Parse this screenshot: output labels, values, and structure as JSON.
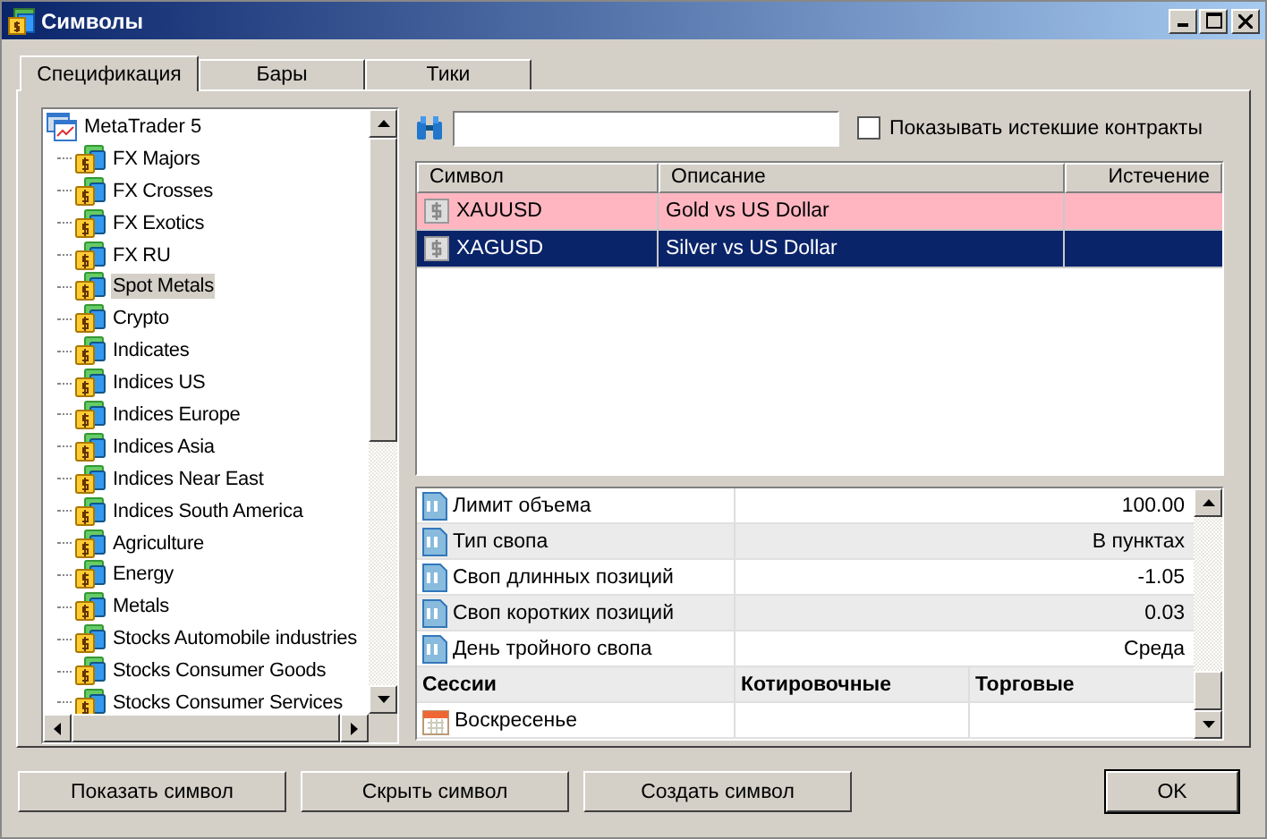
{
  "window": {
    "title": "Символы"
  },
  "tabs": [
    {
      "label": "Спецификация",
      "selected": true
    },
    {
      "label": "Бары",
      "selected": false
    },
    {
      "label": "Тики",
      "selected": false
    }
  ],
  "tree": {
    "label": "MetaTrader 5",
    "children": [
      {
        "label": "FX Majors",
        "selected": false
      },
      {
        "label": "FX Crosses",
        "selected": false
      },
      {
        "label": "FX Exotics",
        "selected": false
      },
      {
        "label": "FX RU",
        "selected": false
      },
      {
        "label": "Spot Metals",
        "selected": true
      },
      {
        "label": "Crypto",
        "selected": false
      },
      {
        "label": "Indicates",
        "selected": false
      },
      {
        "label": "Indices US",
        "selected": false
      },
      {
        "label": "Indices Europe",
        "selected": false
      },
      {
        "label": "Indices Asia",
        "selected": false
      },
      {
        "label": "Indices Near East",
        "selected": false
      },
      {
        "label": "Indices South America",
        "selected": false
      },
      {
        "label": "Agriculture",
        "selected": false
      },
      {
        "label": "Energy",
        "selected": false
      },
      {
        "label": "Metals",
        "selected": false
      },
      {
        "label": "Stocks Automobile industries",
        "selected": false
      },
      {
        "label": "Stocks Consumer Goods",
        "selected": false
      },
      {
        "label": "Stocks Consumer Services",
        "selected": false
      }
    ]
  },
  "search": {
    "show_expired_label": "Показывать истекшие контракты",
    "show_expired_checked": false
  },
  "symbols": {
    "columns": [
      "Символ",
      "Описание",
      "Истечение"
    ],
    "rows": [
      {
        "symbol": "XAUUSD",
        "description": "Gold vs US Dollar",
        "color": "#ffb6c1",
        "selected": false
      },
      {
        "symbol": "XAGUSD",
        "description": "Silver vs US Dollar",
        "color": "#0a246a",
        "selected": true
      }
    ]
  },
  "properties": [
    {
      "name": "Лимит объема",
      "value": "100.00"
    },
    {
      "name": "Тип свопа",
      "value": "В пунктах"
    },
    {
      "name": "Своп длинных позиций",
      "value": "-1.05"
    },
    {
      "name": "Своп коротких позиций",
      "value": "0.03"
    },
    {
      "name": "День тройного свопа",
      "value": "Среда"
    }
  ],
  "sessions": {
    "columns": [
      "Сессии",
      "Котировочные",
      "Торговые"
    ],
    "rows": [
      {
        "day": "Воскресенье"
      }
    ]
  },
  "buttons": [
    "Показать символ",
    "Скрыть символ",
    "Создать символ"
  ],
  "ok_button": "OK"
}
